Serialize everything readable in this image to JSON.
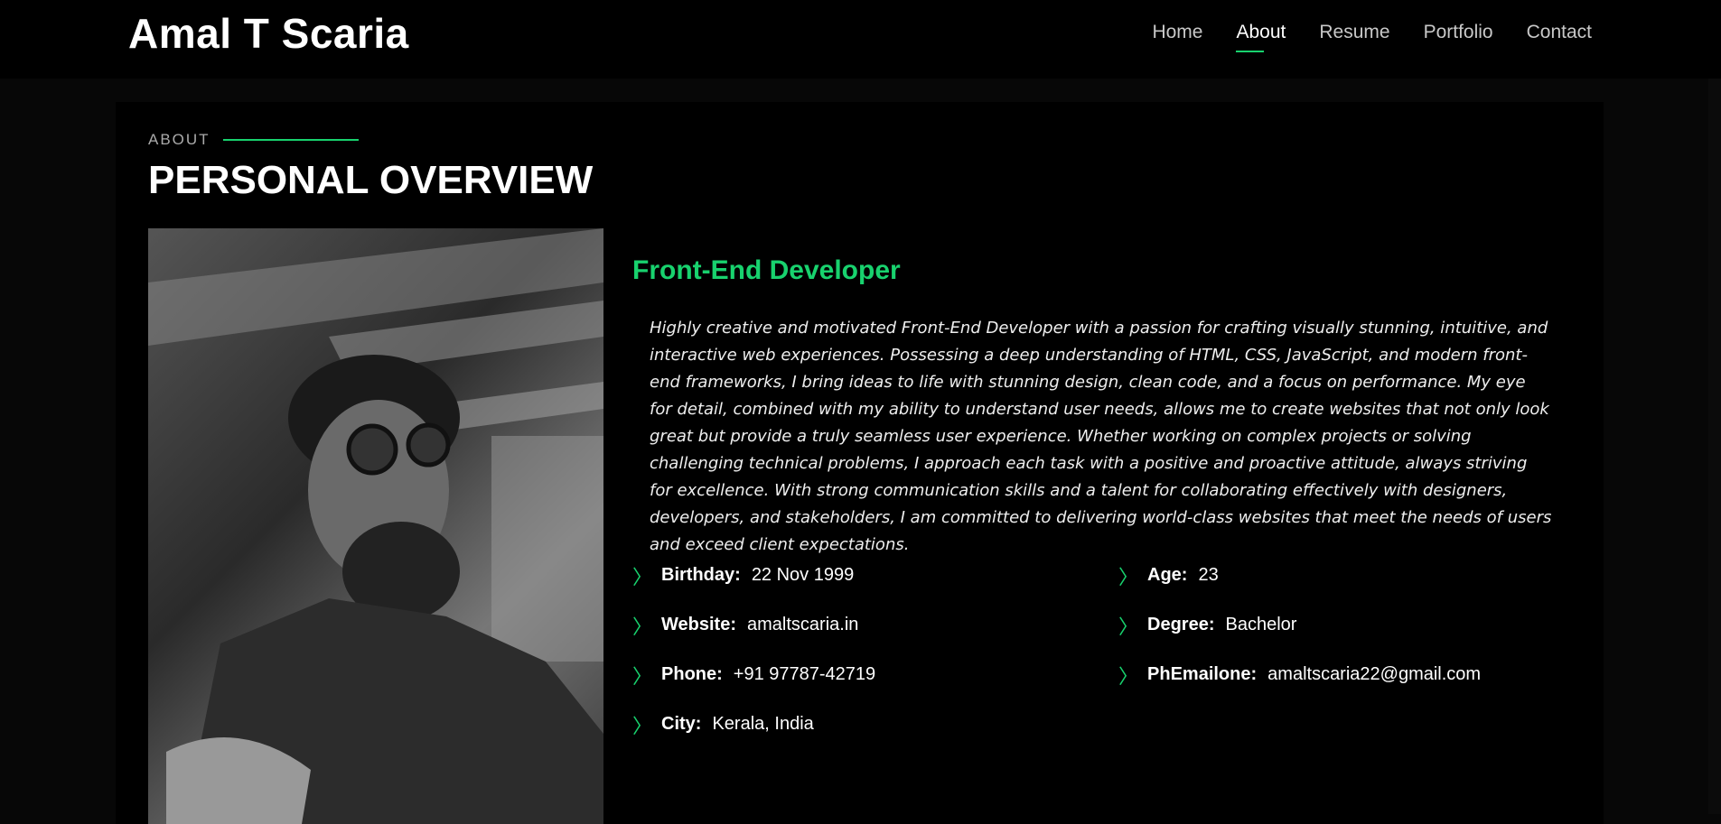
{
  "header": {
    "logo": "Amal T Scaria",
    "nav": [
      "Home",
      "About",
      "Resume",
      "Portfolio",
      "Contact"
    ],
    "active": "About"
  },
  "section": {
    "kicker": "ABOUT",
    "title": "PERSONAL OVERVIEW"
  },
  "profile": {
    "role": "Front-End Developer",
    "bio": "Highly creative and motivated Front-End Developer with a passion for crafting visually stunning, intuitive, and interactive web experiences. Possessing a deep understanding of HTML, CSS, JavaScript, and modern front-end frameworks, I bring ideas to life with stunning design, clean code, and a focus on performance. My eye for detail, combined with my ability to understand user needs, allows me to create websites that not only look great but provide a truly seamless user experience. Whether working on complex projects or solving challenging technical problems, I approach each task with a positive and proactive attitude, always striving for excellence. With strong communication skills and a talent for collaborating effectively with designers, developers, and stakeholders, I am committed to delivering world-class websites that meet the needs of users and exceed client expectations.",
    "left": [
      {
        "label": "Birthday:",
        "value": "22 Nov 1999"
      },
      {
        "label": "Website:",
        "value": "amaltscaria.in"
      },
      {
        "label": "Phone:",
        "value": "+91 97787-42719"
      },
      {
        "label": "City:",
        "value": "Kerala, India"
      }
    ],
    "right": [
      {
        "label": "Age:",
        "value": "23"
      },
      {
        "label": "Degree:",
        "value": "Bachelor"
      },
      {
        "label": "PhEmailone:",
        "value": "amaltscaria22@gmail.com"
      }
    ]
  },
  "colors": {
    "accent": "#18d26e"
  }
}
